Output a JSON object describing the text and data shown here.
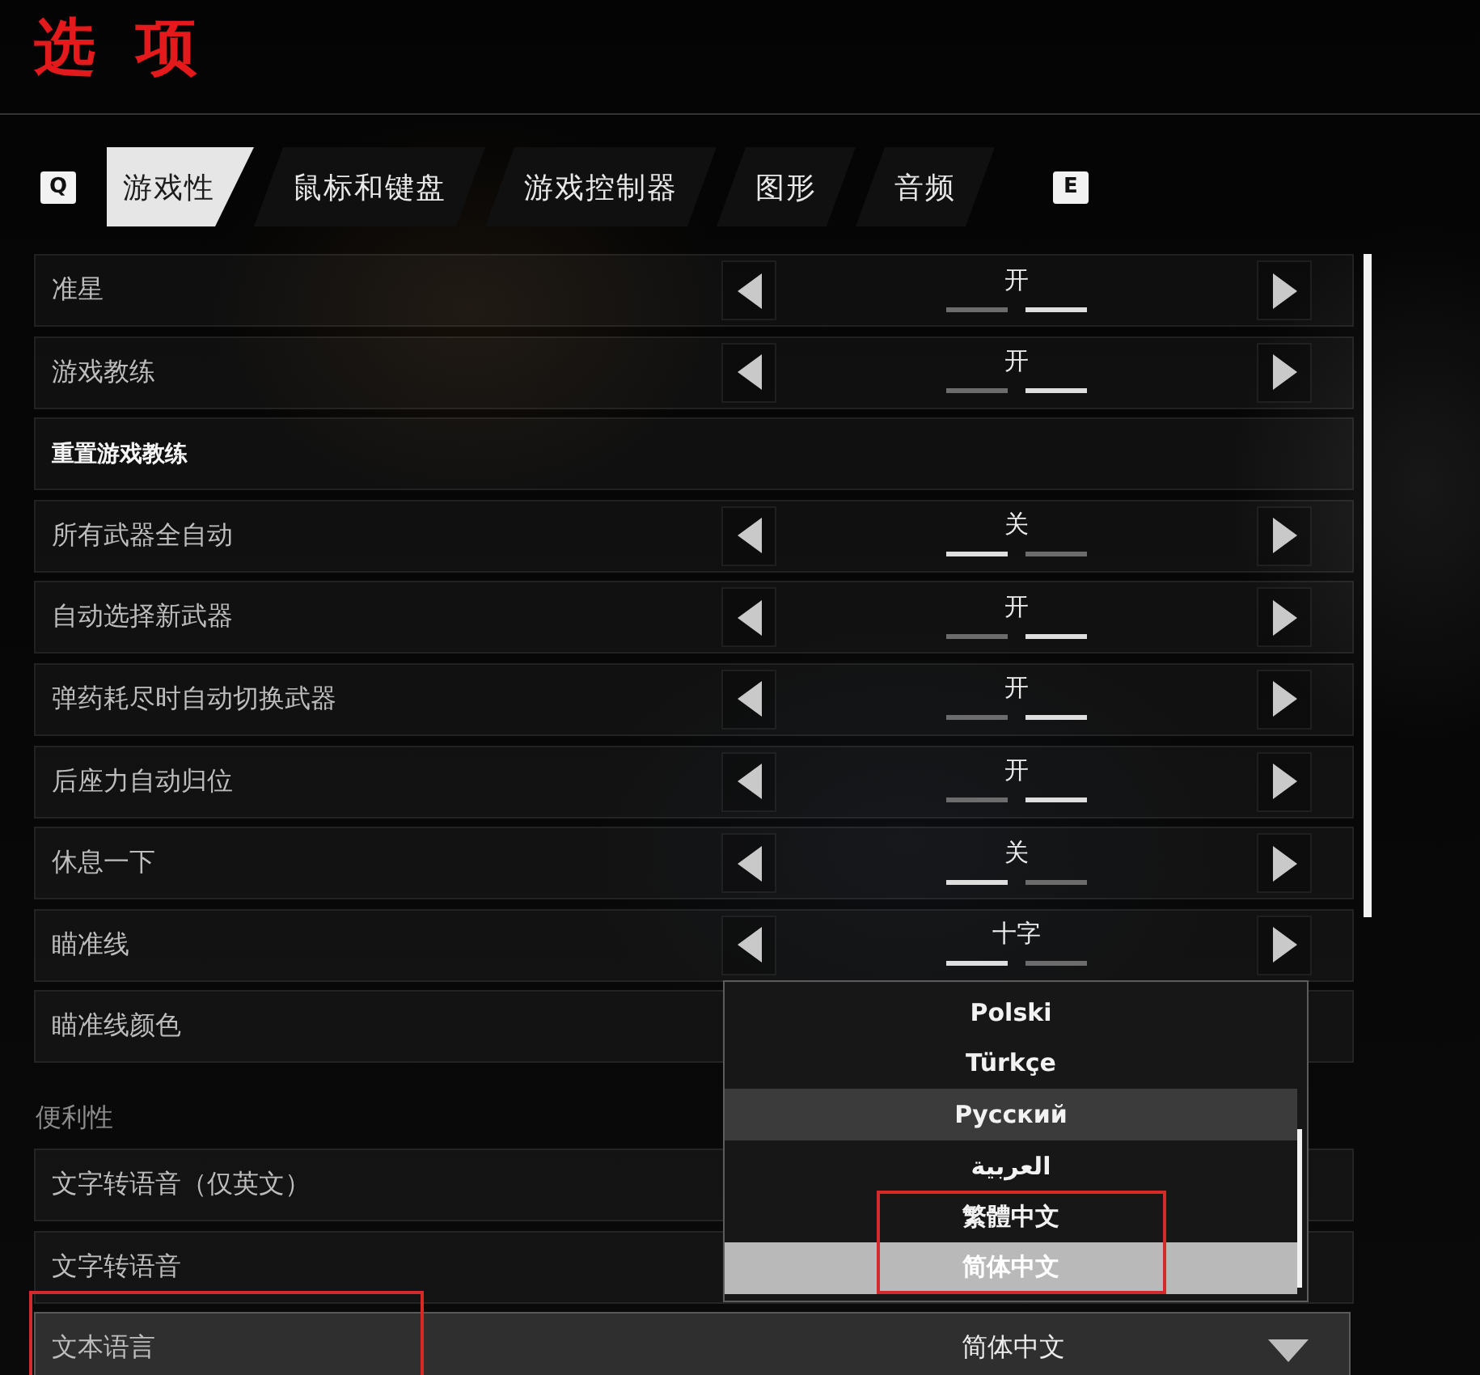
{
  "window": {
    "title": "选 项"
  },
  "tab_bar": {
    "prev_key": "Q",
    "tabs": [
      {
        "label": "游戏性",
        "selected": true
      },
      {
        "label": "鼠标和键盘",
        "selected": false
      },
      {
        "label": "游戏控制器",
        "selected": false
      },
      {
        "label": "图形",
        "selected": false
      },
      {
        "label": "音频",
        "selected": false
      }
    ],
    "next_key": "E"
  },
  "settings": [
    {
      "kind": "toggle",
      "label": "准星",
      "value": "开",
      "segments": [
        {
          "selected": false
        },
        {
          "selected": true
        }
      ]
    },
    {
      "kind": "toggle",
      "label": "游戏教练",
      "value": "开",
      "segments": [
        {
          "selected": false
        },
        {
          "selected": true
        }
      ]
    },
    {
      "kind": "action",
      "label": "重置游戏教练"
    },
    {
      "kind": "toggle",
      "label": "所有武器全自动",
      "value": "关",
      "segments": [
        {
          "selected": true
        },
        {
          "selected": false
        }
      ]
    },
    {
      "kind": "toggle",
      "label": "自动选择新武器",
      "value": "开",
      "segments": [
        {
          "selected": false
        },
        {
          "selected": true
        }
      ]
    },
    {
      "kind": "toggle",
      "label": "弹药耗尽时自动切换武器",
      "value": "开",
      "segments": [
        {
          "selected": false
        },
        {
          "selected": true
        }
      ]
    },
    {
      "kind": "toggle",
      "label": "后座力自动归位",
      "value": "开",
      "segments": [
        {
          "selected": false
        },
        {
          "selected": true
        }
      ]
    },
    {
      "kind": "toggle",
      "label": "休息一下",
      "value": "关",
      "segments": [
        {
          "selected": true
        },
        {
          "selected": false
        }
      ]
    },
    {
      "kind": "toggle",
      "label": "瞄准线",
      "value": "十字",
      "segments": [
        {
          "selected": true
        },
        {
          "selected": false
        }
      ]
    },
    {
      "kind": "plain",
      "label": "瞄准线颜色"
    }
  ],
  "accessibility": {
    "heading": "便利性",
    "settings": [
      {
        "kind": "plain",
        "label": "文字转语音（仅英文）"
      },
      {
        "kind": "plain",
        "label": "文字转语音"
      },
      {
        "kind": "dropdown",
        "label": "文本语言",
        "value": "简体中文",
        "highlighted": true
      }
    ]
  },
  "language_dropdown": {
    "options": [
      {
        "label": "Polski",
        "selected": false,
        "hovered": false,
        "highlighted": false
      },
      {
        "label": "Türkçe",
        "selected": false,
        "hovered": false,
        "highlighted": false
      },
      {
        "label": "Русский",
        "selected": false,
        "hovered": true,
        "highlighted": false
      },
      {
        "label": "العربية",
        "selected": false,
        "hovered": false,
        "highlighted": false
      },
      {
        "label": "繁體中文",
        "selected": false,
        "hovered": false,
        "highlighted": true
      },
      {
        "label": "简体中文",
        "selected": true,
        "hovered": false,
        "highlighted": true
      }
    ]
  }
}
